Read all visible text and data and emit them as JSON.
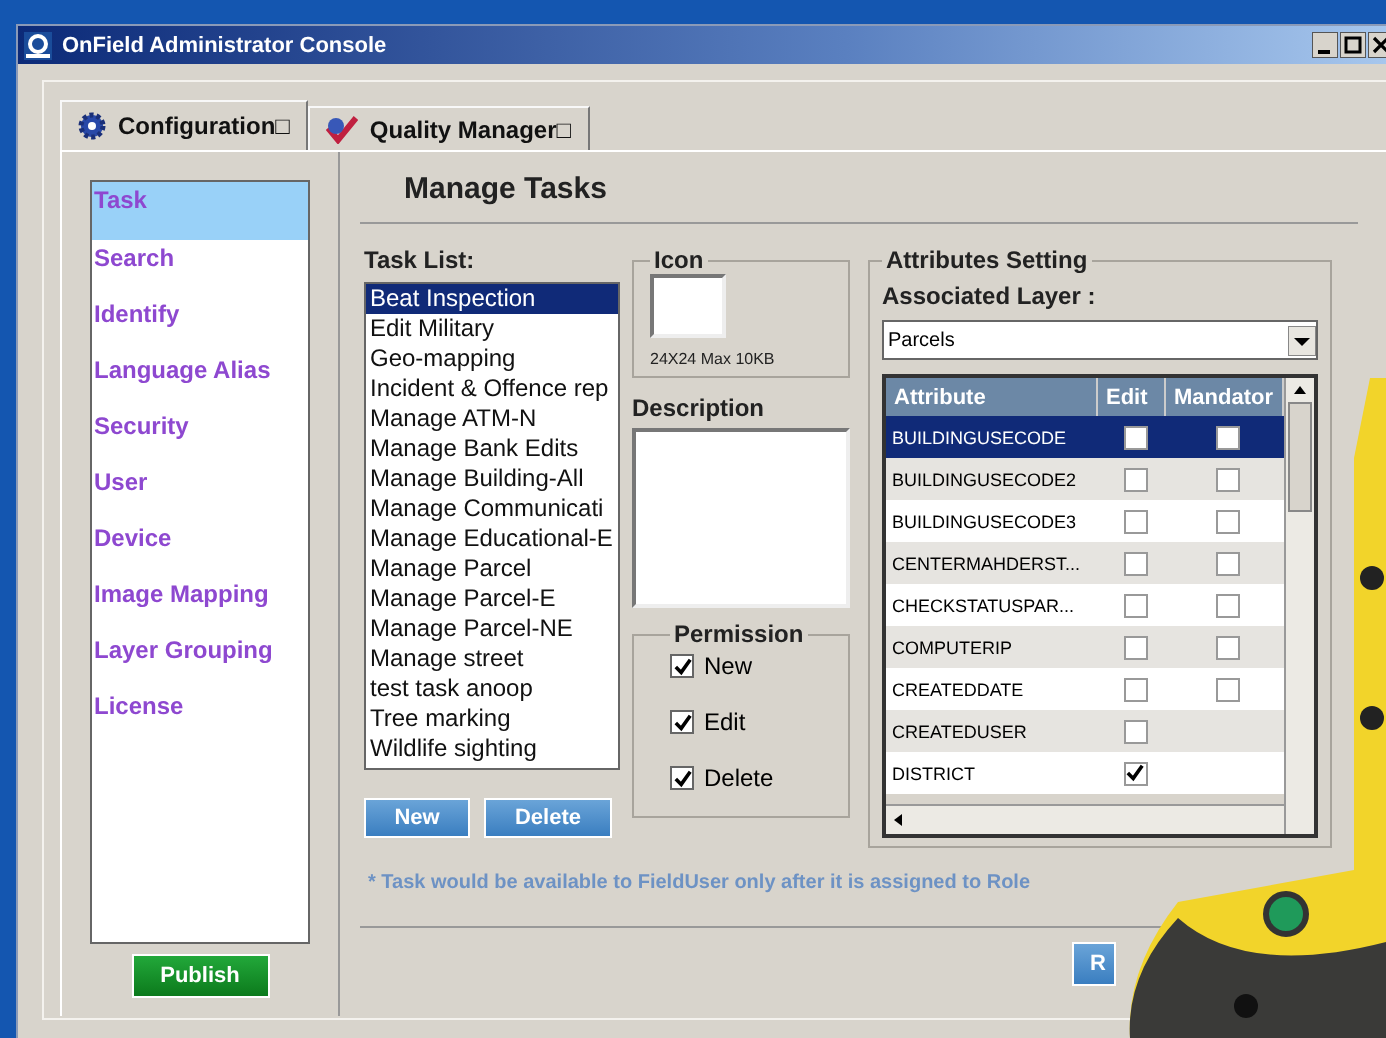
{
  "window": {
    "title": "OnField Administrator Console"
  },
  "tabs": [
    {
      "label": "Configuration□",
      "selected": true
    },
    {
      "label": "Quality Manager□",
      "selected": false
    }
  ],
  "sidebar": {
    "items": [
      {
        "label": "Task",
        "selected": true
      },
      {
        "label": "Search",
        "selected": false
      },
      {
        "label": "Identify",
        "selected": false
      },
      {
        "label": "Language Alias",
        "selected": false
      },
      {
        "label": "Security",
        "selected": false
      },
      {
        "label": "User",
        "selected": false
      },
      {
        "label": "Device",
        "selected": false
      },
      {
        "label": "Image Mapping",
        "selected": false
      },
      {
        "label": "Layer Grouping",
        "selected": false
      },
      {
        "label": "License",
        "selected": false
      }
    ]
  },
  "publish_button": "Publish",
  "heading": "Manage Tasks",
  "task_list": {
    "label": "Task List:",
    "items": [
      {
        "label": "Beat Inspection",
        "selected": true
      },
      {
        "label": "Edit Military",
        "selected": false
      },
      {
        "label": "Geo-mapping",
        "selected": false
      },
      {
        "label": "Incident & Offence rep",
        "selected": false
      },
      {
        "label": "Manage ATM-N",
        "selected": false
      },
      {
        "label": "Manage Bank Edits",
        "selected": false
      },
      {
        "label": "Manage Building-All",
        "selected": false
      },
      {
        "label": "Manage Communicati",
        "selected": false
      },
      {
        "label": "Manage Educational-E",
        "selected": false
      },
      {
        "label": "Manage Parcel",
        "selected": false
      },
      {
        "label": "Manage Parcel-E",
        "selected": false
      },
      {
        "label": "Manage Parcel-NE",
        "selected": false
      },
      {
        "label": "Manage street",
        "selected": false
      },
      {
        "label": "test task anoop",
        "selected": false
      },
      {
        "label": "Tree marking",
        "selected": false
      },
      {
        "label": "Wildlife sighting",
        "selected": false
      }
    ],
    "buttons": [
      "New",
      "Delete"
    ]
  },
  "icon_group": {
    "title": "Icon",
    "hint": "24X24 Max 10KB"
  },
  "description": {
    "label": "Description"
  },
  "permission": {
    "title": "Permission",
    "options": [
      {
        "label": "New",
        "checked": true
      },
      {
        "label": "Edit",
        "checked": true
      },
      {
        "label": "Delete",
        "checked": true
      }
    ]
  },
  "attributes": {
    "title": "Attributes Setting",
    "layer_label": "Associated Layer :",
    "layer_value": "Parcels",
    "columns": [
      "Attribute",
      "Edit",
      "Mandator"
    ],
    "rows": [
      {
        "attribute": "BUILDINGUSECODE",
        "edit": false,
        "mandatory": false,
        "selected": true
      },
      {
        "attribute": "BUILDINGUSECODE2",
        "edit": false,
        "mandatory": false,
        "selected": false
      },
      {
        "attribute": "BUILDINGUSECODE3",
        "edit": false,
        "mandatory": false,
        "selected": false
      },
      {
        "attribute": "CENTERMAHDERST...",
        "edit": false,
        "mandatory": false,
        "selected": false
      },
      {
        "attribute": "CHECKSTATUSPAR...",
        "edit": false,
        "mandatory": false,
        "selected": false
      },
      {
        "attribute": "COMPUTERIP",
        "edit": false,
        "mandatory": false,
        "selected": false
      },
      {
        "attribute": "CREATEDDATE",
        "edit": false,
        "mandatory": false,
        "selected": false
      },
      {
        "attribute": "CREATEDUSER",
        "edit": false,
        "selected": false
      },
      {
        "attribute": "DISTRICT",
        "edit": true,
        "selected": false
      }
    ]
  },
  "note": "* Task would be available to FieldUser only after it is assigned to Role",
  "bottom_button": "R"
}
